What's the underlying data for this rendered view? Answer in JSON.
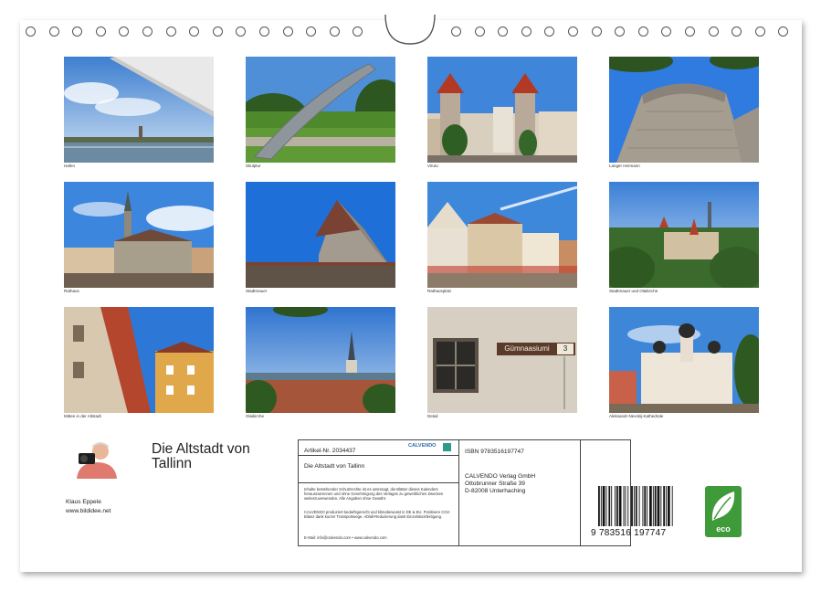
{
  "photos": [
    {
      "caption": "Hafen"
    },
    {
      "caption": "Skulptur"
    },
    {
      "caption": "Viruto"
    },
    {
      "caption": "Langer Hermann"
    },
    {
      "caption": "Rathaus"
    },
    {
      "caption": "Stadtmauer"
    },
    {
      "caption": "Rathausplatz"
    },
    {
      "caption": "Stadtmauer und Olaikirche"
    },
    {
      "caption": "Mitten in der Altstadt"
    },
    {
      "caption": "Olaikirche"
    },
    {
      "caption": "Detail"
    },
    {
      "caption": "Aleksandr-Nevskij-Kathedrale"
    }
  ],
  "sign_text": "Gümnaasiumi",
  "sign_number": "3",
  "title_line1": "Die Altstadt von",
  "title_line2": "Tallinn",
  "author_name": "Klaus Eppele",
  "author_site": "www.bildidee.net",
  "imprint": {
    "article": "Artikel-Nr. 2034437",
    "brand": "CALVENDO",
    "subject": "Die Altstadt von Tallinn",
    "legal": "Inhalte bestehender Schutzrechte ist es untersagt, die Blätter dieses Kalenders herauszutrennen und ohne Genehmigung des Verlages zu gewerblichen Zwecken weiterzuverwenden. Alle Angaben ohne Gewähr.",
    "eco_note": "CALVENDO produziert bedarfsgerecht und klimabewusst in DE & EU. Positivere CO2-Bilanz dank kurzer Transportwege. Abfall-Reduzierung dank Einzelstückfertigung.",
    "contact": "E-Mail: info@calvendo.com • www.calvendo.com",
    "isbn": "ISBN 9783516197747",
    "publisher": "CALVENDO Verlag GmbH",
    "street": "Ottobrunner Straße 39",
    "city": "D-82008 Unterhaching",
    "barcode_digits": "9 783516 197747",
    "eco_label": "eco"
  }
}
